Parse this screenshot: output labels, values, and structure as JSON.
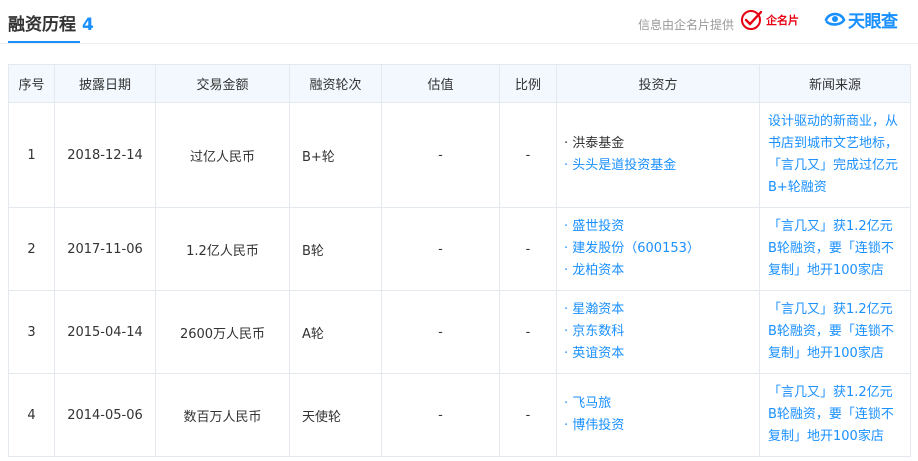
{
  "section": {
    "title": "融资历程",
    "count": "4",
    "provider_text": "信息由企名片提供",
    "provider_logo": "企名片",
    "brand": "天眼查",
    "accent_color": "#1a90ff",
    "brand_red": "#e60012"
  },
  "table": {
    "columns": [
      "序号",
      "披露日期",
      "交易金额",
      "融资轮次",
      "估值",
      "比例",
      "投资方",
      "新闻来源"
    ],
    "rows": [
      {
        "index": "1",
        "date": "2018-12-14",
        "amount": "过亿人民币",
        "round": "B+轮",
        "valuation": "-",
        "ratio": "-",
        "investors": [
          {
            "name": "· 洪泰基金",
            "link": false
          },
          {
            "name": "· 头头是道投资基金",
            "link": true
          }
        ],
        "news": "设计驱动的新商业，从书店到城市文艺地标，「言几又」完成过亿元B+轮融资"
      },
      {
        "index": "2",
        "date": "2017-11-06",
        "amount": "1.2亿人民币",
        "round": "B轮",
        "valuation": "-",
        "ratio": "-",
        "investors": [
          {
            "name": "· 盛世投资",
            "link": true
          },
          {
            "name": "· 建发股份（600153）",
            "link": true
          },
          {
            "name": "· 龙柏资本",
            "link": true
          }
        ],
        "news": "「言几又」获1.2亿元B轮融资，要「连锁不复制」地开100家店"
      },
      {
        "index": "3",
        "date": "2015-04-14",
        "amount": "2600万人民币",
        "round": "A轮",
        "valuation": "-",
        "ratio": "-",
        "investors": [
          {
            "name": "· 星瀚资本",
            "link": true
          },
          {
            "name": "· 京东数科",
            "link": true
          },
          {
            "name": "· 英谊资本",
            "link": true
          }
        ],
        "news": "「言几又」获1.2亿元B轮融资，要「连锁不复制」地开100家店"
      },
      {
        "index": "4",
        "date": "2014-05-06",
        "amount": "数百万人民币",
        "round": "天使轮",
        "valuation": "-",
        "ratio": "-",
        "investors": [
          {
            "name": "· 飞马旅",
            "link": true
          },
          {
            "name": "· 博伟投资",
            "link": true
          }
        ],
        "news": "「言几又」获1.2亿元B轮融资，要「连锁不复制」地开100家店"
      }
    ]
  }
}
